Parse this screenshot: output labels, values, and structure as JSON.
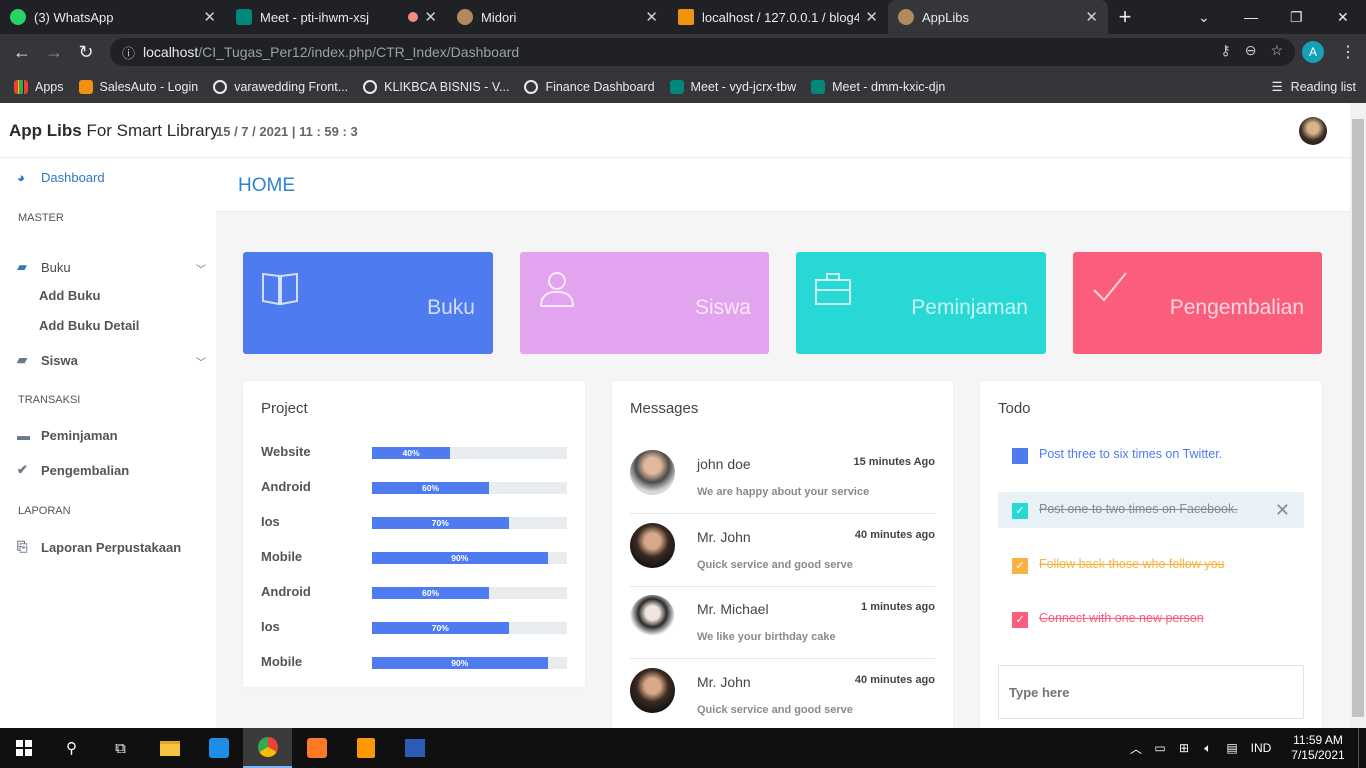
{
  "browser": {
    "tabs": [
      {
        "label": "(3) WhatsApp",
        "icon": "whatsapp-icon",
        "color": "#25d366"
      },
      {
        "label": "Meet - pti-ihwm-xsj",
        "icon": "meet-icon",
        "color": "#00897b"
      },
      {
        "label": "Midori",
        "icon": "midori-icon",
        "color": "#b08a5c"
      },
      {
        "label": "localhost / 127.0.0.1 / blog4 /",
        "icon": "phpmyadmin-icon",
        "color": "#f29111"
      },
      {
        "label": "AppLibs",
        "icon": "applibs-icon",
        "color": "#b08a5c"
      }
    ],
    "url_host": "localhost",
    "url_path": "/CI_Tugas_Per12/index.php/CTR_Index/Dashboard",
    "profile_initial": "A",
    "bookmarks": [
      {
        "label": "Apps",
        "icon": "apps-grid-icon"
      },
      {
        "label": "SalesAuto - Login",
        "icon": "salesauto-icon"
      },
      {
        "label": "varawedding Front...",
        "icon": "globe-icon"
      },
      {
        "label": "KLIKBCA BISNIS - V...",
        "icon": "globe-icon"
      },
      {
        "label": "Finance Dashboard",
        "icon": "globe-icon"
      },
      {
        "label": "Meet - vyd-jcrx-tbw",
        "icon": "meet-icon"
      },
      {
        "label": "Meet - dmm-kxic-djn",
        "icon": "meet-icon"
      }
    ],
    "reading_list": "Reading list"
  },
  "header": {
    "brand_bold": "App Libs",
    "brand_rest": " For Smart Library",
    "clock": "15 / 7 / 2021 | 11 : 59 : 3"
  },
  "sidebar": {
    "dashboard": "Dashboard",
    "master": "MASTER",
    "buku": "Buku",
    "add_buku": "Add Buku",
    "add_buku_detail": "Add Buku Detail",
    "siswa": "Siswa",
    "transaksi": "TRANSAKSI",
    "peminjaman": "Peminjaman",
    "pengembalian": "Pengembalian",
    "laporan": "LAPORAN",
    "laporan_perpustakaan": "Laporan Perpustakaan"
  },
  "page": {
    "title": "HOME"
  },
  "cards": [
    {
      "label": "Buku",
      "color": "#4e7bf0",
      "icon": "book-icon"
    },
    {
      "label": "Siswa",
      "color": "#e2a4ef",
      "icon": "user-icon"
    },
    {
      "label": "Peminjaman",
      "color": "#27d8d5",
      "icon": "briefcase-icon"
    },
    {
      "label": "Pengembalian",
      "color": "#fb5e7d",
      "icon": "check-icon"
    }
  ],
  "project": {
    "title": "Project",
    "rows": [
      {
        "name": "Website",
        "percent": 40,
        "label": "40%"
      },
      {
        "name": "Android",
        "percent": 60,
        "label": "60%"
      },
      {
        "name": "Ios",
        "percent": 70,
        "label": "70%"
      },
      {
        "name": "Mobile",
        "percent": 90,
        "label": "90%"
      },
      {
        "name": "Android",
        "percent": 60,
        "label": "60%"
      },
      {
        "name": "Ios",
        "percent": 70,
        "label": "70%"
      },
      {
        "name": "Mobile",
        "percent": 90,
        "label": "90%"
      }
    ]
  },
  "messages": {
    "title": "Messages",
    "items": [
      {
        "name": "john doe",
        "time": "15 minutes Ago",
        "text": "We are happy about your service"
      },
      {
        "name": "Mr. John",
        "time": "40 minutes ago",
        "text": "Quick service and good serve"
      },
      {
        "name": "Mr. Michael",
        "time": "1 minutes ago",
        "text": "We like your birthday cake"
      },
      {
        "name": "Mr. John",
        "time": "40 minutes ago",
        "text": "Quick service and good serve"
      }
    ]
  },
  "todo": {
    "title": "Todo",
    "items": [
      {
        "text": "Post three to six times on Twitter.",
        "color": "#4e7bf0",
        "done": false
      },
      {
        "text": "Post one to two times on Facebook.",
        "color": "#27d8d5",
        "done": true
      },
      {
        "text": "Follow back those who follow you",
        "color": "#f7b340",
        "done": true
      },
      {
        "text": "Connect with one new person",
        "color": "#fb5e7d",
        "done": true
      }
    ],
    "placeholder": "Type here"
  },
  "taskbar": {
    "lang": "IND",
    "time": "11:59 AM",
    "date": "7/15/2021"
  }
}
